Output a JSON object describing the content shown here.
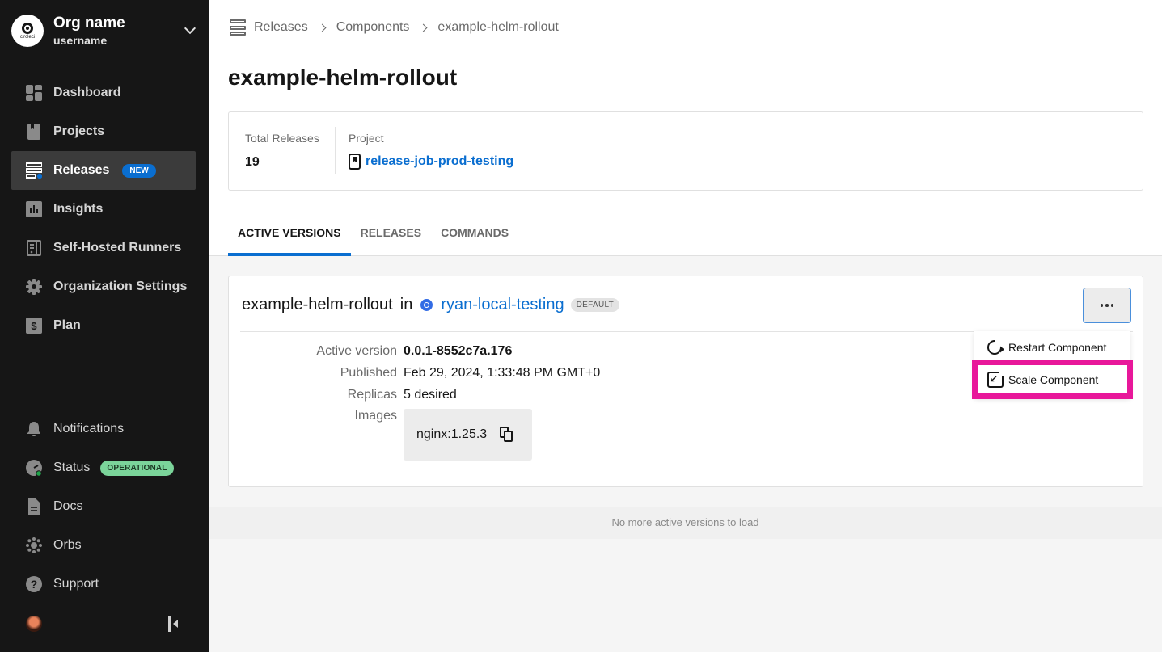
{
  "sidebar": {
    "org_name": "Org name",
    "username": "username",
    "logo_text": "circleci",
    "nav_top": [
      {
        "label": "Dashboard",
        "icon": "dashboard-icon"
      },
      {
        "label": "Projects",
        "icon": "projects-icon"
      },
      {
        "label": "Releases",
        "icon": "releases-icon",
        "badge": "NEW",
        "active": true
      },
      {
        "label": "Insights",
        "icon": "insights-icon"
      },
      {
        "label": "Self-Hosted Runners",
        "icon": "runners-icon"
      },
      {
        "label": "Organization Settings",
        "icon": "gear-icon"
      },
      {
        "label": "Plan",
        "icon": "dollar-icon"
      }
    ],
    "nav_bottom": [
      {
        "label": "Notifications",
        "icon": "bell-icon"
      },
      {
        "label": "Status",
        "icon": "status-gauge-icon",
        "badge": "OPERATIONAL"
      },
      {
        "label": "Docs",
        "icon": "document-icon"
      },
      {
        "label": "Orbs",
        "icon": "orbs-icon"
      },
      {
        "label": "Support",
        "icon": "help-icon"
      }
    ]
  },
  "breadcrumb": [
    "Releases",
    "Components",
    "example-helm-rollout"
  ],
  "page_title": "example-helm-rollout",
  "summary": {
    "total_releases_label": "Total Releases",
    "total_releases_value": "19",
    "project_label": "Project",
    "project_value": "release-job-prod-testing"
  },
  "tabs": [
    {
      "label": "ACTIVE VERSIONS",
      "active": true
    },
    {
      "label": "RELEASES"
    },
    {
      "label": "COMMANDS"
    }
  ],
  "component_card": {
    "name": "example-helm-rollout",
    "in_text": "in",
    "environment": "ryan-local-testing",
    "environment_badge": "DEFAULT",
    "details": [
      {
        "label": "Active version",
        "value": "0.0.1-8552c7a.176"
      },
      {
        "label": "Published",
        "value": "Feb 29, 2024, 1:33:48 PM GMT+0"
      },
      {
        "label": "Replicas",
        "value": "5 desired"
      },
      {
        "label": "Images",
        "value": "nginx:1.25.3"
      }
    ]
  },
  "menu": {
    "items": [
      {
        "label": "Restart Component",
        "icon": "restart-icon"
      },
      {
        "label": "Scale Component",
        "icon": "scale-icon",
        "highlighted": true
      }
    ],
    "highlight_color": "#e8179a"
  },
  "footer_message": "No more active versions to load",
  "colors": {
    "accent": "#0a6ed0",
    "sidebar_bg": "#161616",
    "operational": "#7bd49a"
  }
}
